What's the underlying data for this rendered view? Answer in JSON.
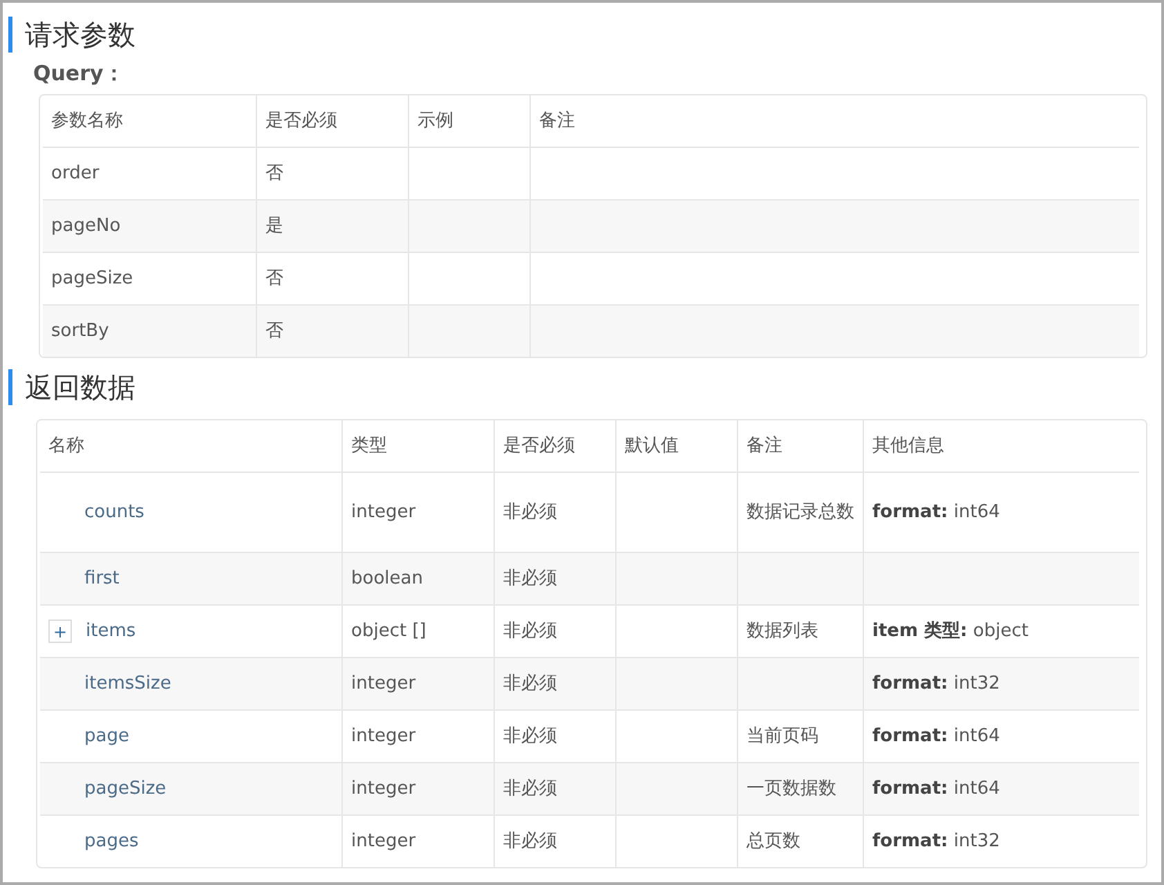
{
  "request": {
    "title": "请求参数",
    "query_label": "Query：",
    "columns": [
      "参数名称",
      "是否必须",
      "示例",
      "备注"
    ],
    "rows": [
      {
        "cells": [
          "order",
          "否",
          "",
          ""
        ]
      },
      {
        "cells": [
          "pageNo",
          "是",
          "",
          ""
        ]
      },
      {
        "cells": [
          "pageSize",
          "否",
          "",
          ""
        ]
      },
      {
        "cells": [
          "sortBy",
          "否",
          "",
          ""
        ]
      }
    ]
  },
  "response": {
    "title": "返回数据",
    "columns": [
      "名称",
      "类型",
      "是否必须",
      "默认值",
      "备注",
      "其他信息"
    ],
    "rows": [
      {
        "cells": [
          "counts",
          "integer",
          "非必须",
          "",
          "数据记录总数",
          "**format:** int64"
        ]
      },
      {
        "cells": [
          "first",
          "boolean",
          "非必须",
          "",
          "",
          ""
        ]
      },
      {
        "cells": [
          "items",
          "object []",
          "非必须",
          "",
          "数据列表",
          "**item 类型:** object"
        ],
        "expand_button": "+"
      },
      {
        "cells": [
          "itemsSize",
          "integer",
          "非必须",
          "",
          "",
          "**format:** int32"
        ]
      },
      {
        "cells": [
          "page",
          "integer",
          "非必须",
          "",
          "当前页码",
          "**format:** int64"
        ]
      },
      {
        "cells": [
          "pageSize",
          "integer",
          "非必须",
          "",
          "一页数据数",
          "**format:** int64"
        ]
      },
      {
        "cells": [
          "pages",
          "integer",
          "非必须",
          "",
          "总页数",
          "**format:** int32"
        ]
      }
    ]
  }
}
